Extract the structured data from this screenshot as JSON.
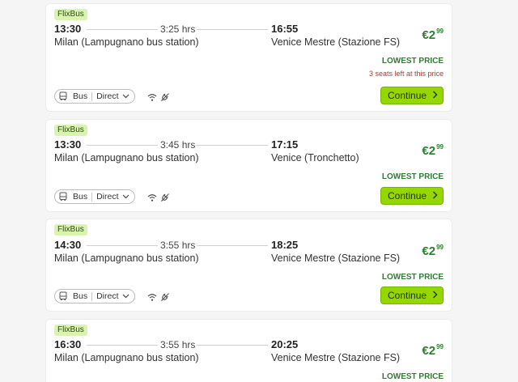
{
  "trips": [
    {
      "operator": "FlixBus",
      "depart_time": "13:30",
      "duration": "3:25 hrs",
      "arrive_time": "16:55",
      "from_station": "Milan (Lampugnano bus station)",
      "to_station": "Venice Mestre (Stazione FS)",
      "price_main": "€2",
      "price_cents": "99",
      "lowest_label": "LOWEST PRICE",
      "seats_label": "3 seats left at this price",
      "mode_label": "Bus",
      "route_type": "Direct",
      "continue_label": "Continue"
    },
    {
      "operator": "FlixBus",
      "depart_time": "13:30",
      "duration": "3:45 hrs",
      "arrive_time": "17:15",
      "from_station": "Milan (Lampugnano bus station)",
      "to_station": "Venice (Tronchetto)",
      "price_main": "€2",
      "price_cents": "99",
      "lowest_label": "LOWEST PRICE",
      "mode_label": "Bus",
      "route_type": "Direct",
      "continue_label": "Continue"
    },
    {
      "operator": "FlixBus",
      "depart_time": "14:30",
      "duration": "3:55 hrs",
      "arrive_time": "18:25",
      "from_station": "Milan (Lampugnano bus station)",
      "to_station": "Venice Mestre (Stazione FS)",
      "price_main": "€2",
      "price_cents": "99",
      "lowest_label": "LOWEST PRICE",
      "mode_label": "Bus",
      "route_type": "Direct",
      "continue_label": "Continue"
    },
    {
      "operator": "FlixBus",
      "depart_time": "16:30",
      "duration": "3:55 hrs",
      "arrive_time": "20:25",
      "from_station": "Milan (Lampugnano bus station)",
      "to_station": "Venice Mestre (Stazione FS)",
      "price_main": "€2",
      "price_cents": "99",
      "lowest_label": "LOWEST PRICE"
    }
  ],
  "icons": {
    "mode": "bus-icon",
    "dropdown": "chevron-down-icon",
    "wifi": "wifi-icon",
    "power": "power-plug-icon",
    "continue": "chevron-right-icon"
  },
  "colors": {
    "accent": "#97d700",
    "price": "#2e7d32",
    "warning": "#b03a2e",
    "badge_bg": "#d9f3b0"
  }
}
